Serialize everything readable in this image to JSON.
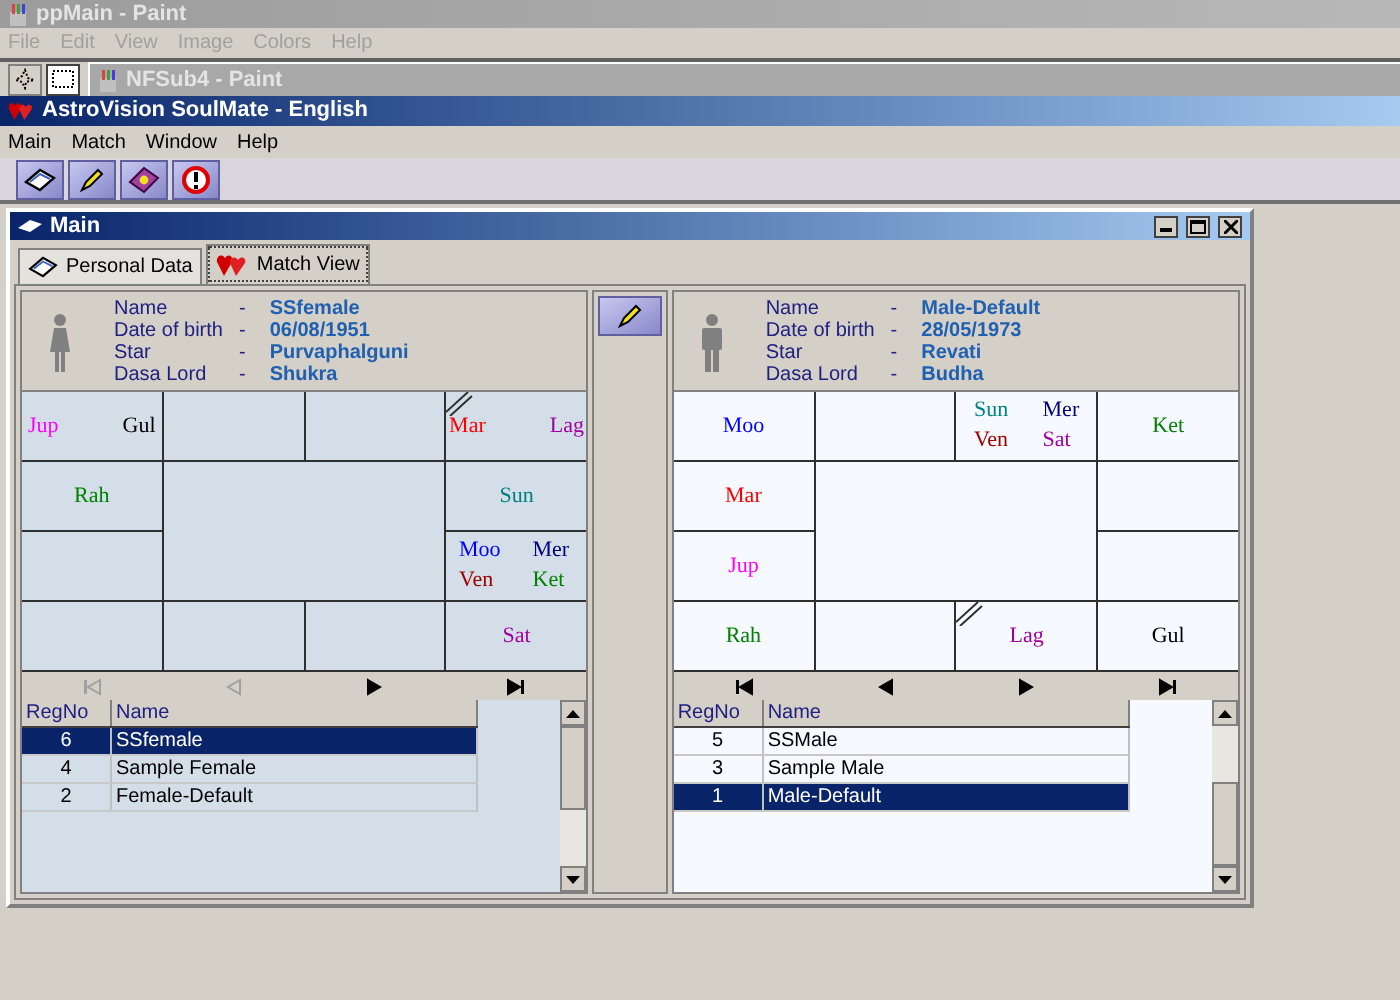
{
  "background_app": {
    "title": "ppMain - Paint",
    "menu": [
      "File",
      "Edit",
      "View",
      "Image",
      "Colors",
      "Help"
    ],
    "subwindow_title": "NFSub4 - Paint"
  },
  "window": {
    "title": "AstroVision SoulMate - English"
  },
  "menu": [
    "Main",
    "Match",
    "Window",
    "Help"
  ],
  "toolbar": [
    {
      "kind": "book"
    },
    {
      "kind": "match"
    },
    {
      "kind": "help"
    },
    {
      "kind": "exit"
    }
  ],
  "child_window": {
    "title": "Main"
  },
  "tabs": [
    {
      "label": "Personal Data",
      "selected": false,
      "kind": "book"
    },
    {
      "label": "Match View",
      "selected": true,
      "kind": "hearts"
    }
  ],
  "panels": [
    {
      "kind": "female",
      "fields": [
        {
          "label": "Name",
          "separator": "-",
          "value": "SSfemale"
        },
        {
          "label": "Date of birth",
          "separator": "-",
          "value": "06/08/1951"
        },
        {
          "label": "Star",
          "separator": "-",
          "value": "Purvaphalguni"
        },
        {
          "label": "Dasa Lord",
          "separator": "-",
          "value": "Shukra"
        }
      ],
      "chart": {
        "cells": [
          {
            "lagna": false,
            "planets": [
              {
                "name": "Jup",
                "color": "#ff00ff"
              },
              {
                "name": "Gul",
                "color": "#000000"
              }
            ]
          },
          {
            "lagna": false
          },
          {
            "lagna": false
          },
          {
            "lagna": true,
            "planets": [
              {
                "name": "Mar",
                "color": "#ff0000"
              },
              {
                "name": "Lag",
                "color": "#a000a0"
              }
            ]
          },
          {
            "lagna": false,
            "planets": [
              {
                "name": "Rah",
                "color": "#008000"
              }
            ]
          },
          {
            "lagna": false,
            "planets": [
              {
                "name": "Sun",
                "color": "#008080"
              }
            ]
          },
          {
            "lagna": false
          },
          {
            "lagna": false,
            "planets": [
              {
                "name": "Moo",
                "color": "#0000ff"
              },
              {
                "name": "Mer",
                "color": "#000080"
              },
              {
                "name": "Ven",
                "color": "#a00000"
              },
              {
                "name": "Ket",
                "color": "#008000"
              }
            ]
          },
          {
            "lagna": false
          },
          {
            "lagna": false
          },
          {
            "lagna": false
          },
          {
            "lagna": false,
            "planets": [
              {
                "name": "Sat",
                "color": "#a000a0"
              }
            ]
          }
        ]
      },
      "nav": [
        {
          "kind": "first",
          "disabled": true
        },
        {
          "kind": "prev",
          "disabled": true
        },
        {
          "kind": "next",
          "disabled": false
        },
        {
          "kind": "last",
          "disabled": false
        }
      ],
      "table": {
        "columns": [
          "RegNo",
          "Name"
        ],
        "rows": [
          {
            "cells": [
              "6",
              "SSfemale"
            ],
            "selected": true
          },
          {
            "cells": [
              "4",
              "Sample Female"
            ],
            "selected": false
          },
          {
            "cells": [
              "2",
              "Female-Default"
            ],
            "selected": false
          }
        ]
      }
    },
    {
      "kind": "male",
      "fields": [
        {
          "label": "Name",
          "separator": "-",
          "value": "Male-Default"
        },
        {
          "label": "Date of birth",
          "separator": "-",
          "value": "28/05/1973"
        },
        {
          "label": "Star",
          "separator": "-",
          "value": "Revati"
        },
        {
          "label": "Dasa Lord",
          "separator": "-",
          "value": "Budha"
        }
      ],
      "chart": {
        "cells": [
          {
            "lagna": false,
            "planets": [
              {
                "name": "Moo",
                "color": "#0000ff"
              }
            ]
          },
          {
            "lagna": false
          },
          {
            "lagna": false,
            "planets": [
              {
                "name": "Sun",
                "color": "#008080"
              },
              {
                "name": "Mer",
                "color": "#000080"
              },
              {
                "name": "Ven",
                "color": "#a00000"
              },
              {
                "name": "Sat",
                "color": "#a000a0"
              }
            ]
          },
          {
            "lagna": false,
            "planets": [
              {
                "name": "Ket",
                "color": "#008000"
              }
            ]
          },
          {
            "lagna": false,
            "planets": [
              {
                "name": "Mar",
                "color": "#ff0000"
              }
            ]
          },
          {
            "lagna": false
          },
          {
            "lagna": false,
            "planets": [
              {
                "name": "Jup",
                "color": "#ff00ff"
              }
            ]
          },
          {
            "lagna": false
          },
          {
            "lagna": false,
            "planets": [
              {
                "name": "Rah",
                "color": "#008000"
              }
            ]
          },
          {
            "lagna": false
          },
          {
            "lagna": true,
            "planets": [
              {
                "name": "Lag",
                "color": "#a000a0"
              }
            ]
          },
          {
            "lagna": false,
            "planets": [
              {
                "name": "Gul",
                "color": "#000000"
              }
            ]
          }
        ]
      },
      "nav": [
        {
          "kind": "first",
          "disabled": false
        },
        {
          "kind": "prev",
          "disabled": false
        },
        {
          "kind": "next",
          "disabled": false
        },
        {
          "kind": "last",
          "disabled": false
        }
      ],
      "table": {
        "columns": [
          "RegNo",
          "Name"
        ],
        "rows": [
          {
            "cells": [
              "5",
              "SSMale"
            ],
            "selected": false
          },
          {
            "cells": [
              "3",
              "Sample Male"
            ],
            "selected": false
          },
          {
            "cells": [
              "1",
              "Male-Default"
            ],
            "selected": true
          }
        ]
      }
    }
  ]
}
